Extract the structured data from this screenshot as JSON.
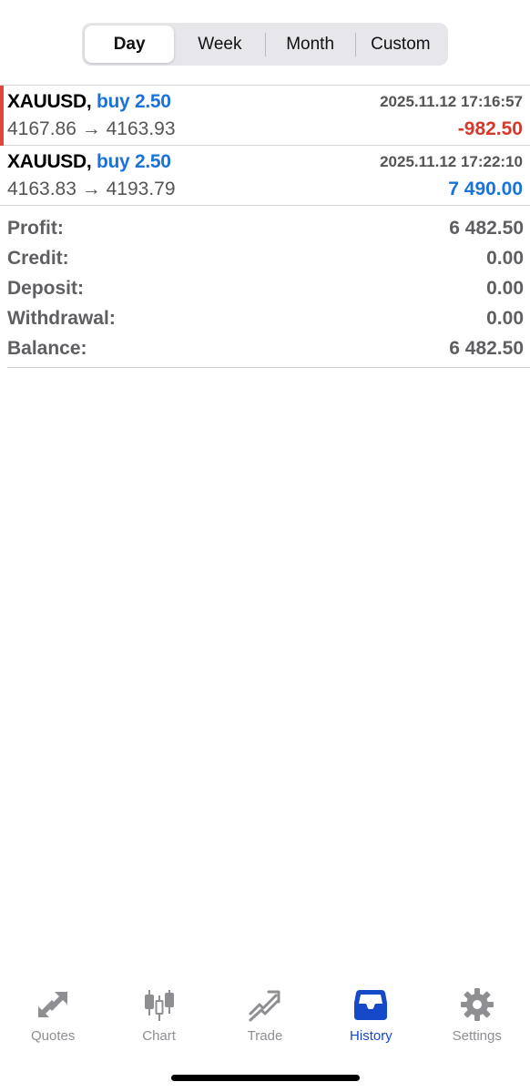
{
  "period_tabs": [
    {
      "label": "Day",
      "active": true
    },
    {
      "label": "Week",
      "active": false
    },
    {
      "label": "Month",
      "active": false
    },
    {
      "label": "Custom",
      "active": false
    }
  ],
  "deals": [
    {
      "symbol": "XAUUSD,",
      "direction": "buy 2.50",
      "time": "2025.11.12 17:16:57",
      "open_price": "4167.86",
      "arrow": "→",
      "close_price": "4163.93",
      "profit": "-982.50",
      "profit_color": "#d6392c"
    },
    {
      "symbol": "XAUUSD,",
      "direction": "buy 2.50",
      "time": "2025.11.12 17:22:10",
      "open_price": "4163.83",
      "arrow": "→",
      "close_price": "4193.79",
      "profit": "7 490.00",
      "profit_color": "#1a73d9"
    }
  ],
  "summary": [
    {
      "label": "Profit:",
      "value": "6 482.50"
    },
    {
      "label": "Credit:",
      "value": "0.00"
    },
    {
      "label": "Deposit:",
      "value": "0.00"
    },
    {
      "label": "Withdrawal:",
      "value": "0.00"
    },
    {
      "label": "Balance:",
      "value": "6 482.50"
    }
  ],
  "tabbar": [
    {
      "label": "Quotes",
      "icon": "quotes-arrows-icon",
      "active": false
    },
    {
      "label": "Chart",
      "icon": "candlestick-icon",
      "active": false
    },
    {
      "label": "Trade",
      "icon": "trend-lines-icon",
      "active": false
    },
    {
      "label": "History",
      "icon": "inbox-tray-icon",
      "active": true
    },
    {
      "label": "Settings",
      "icon": "gear-icon",
      "active": false
    }
  ],
  "colors": {
    "accent": "#1549c8",
    "buy": "#1a73d9",
    "loss": "#d6392c",
    "inactive": "#8e8e93"
  }
}
